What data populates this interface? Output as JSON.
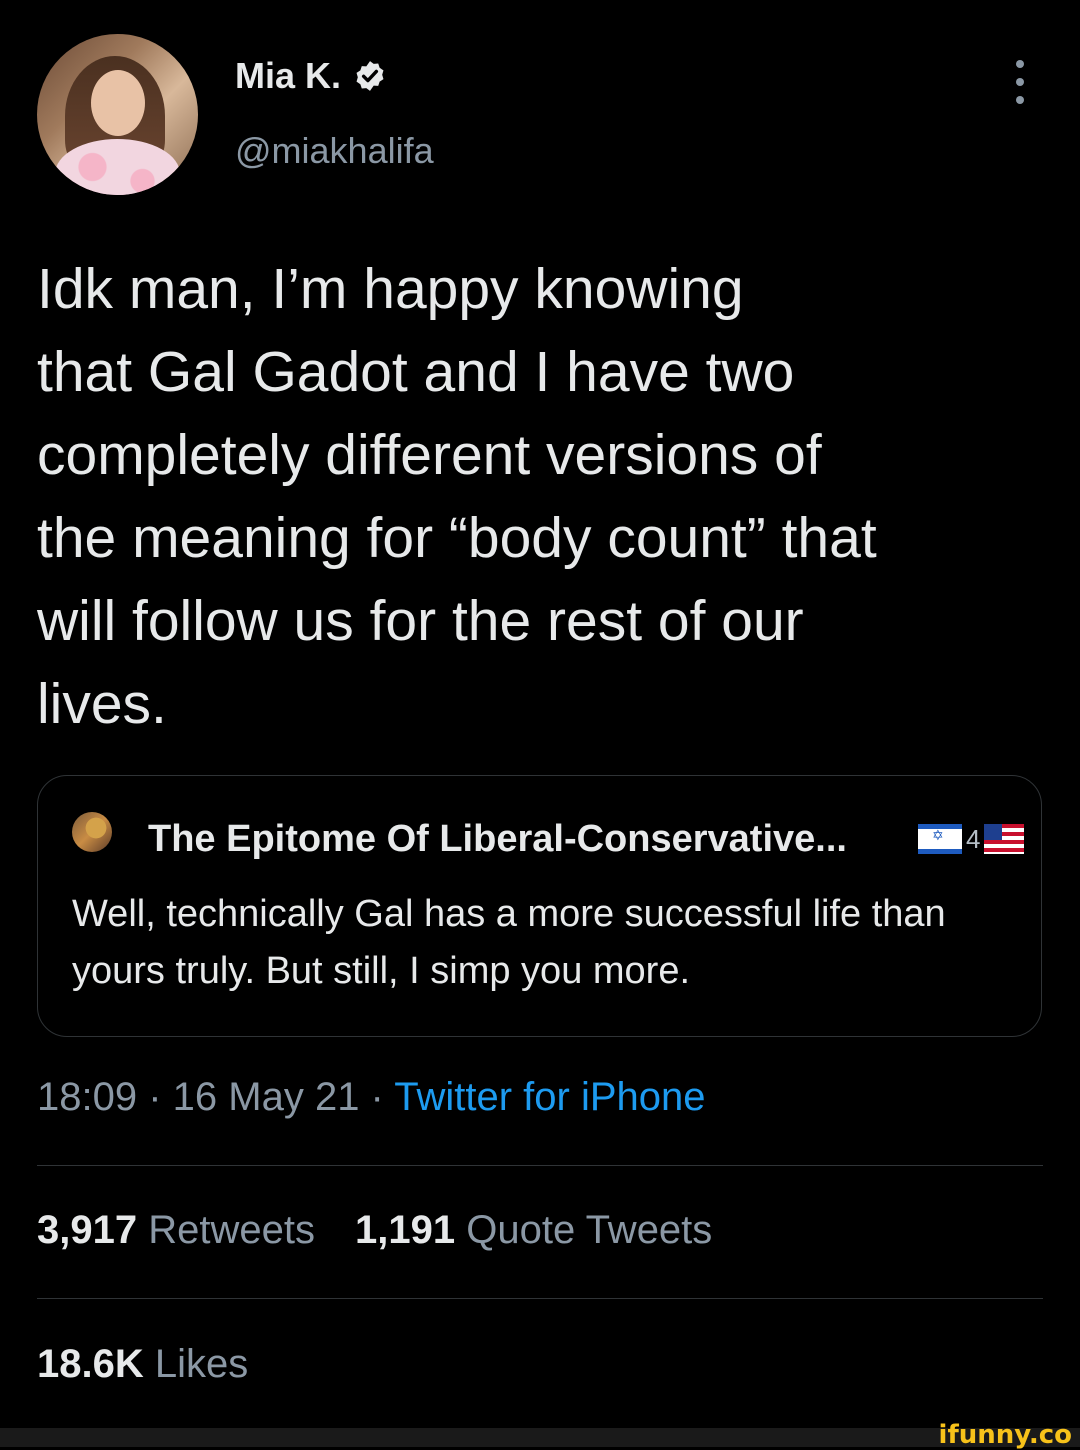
{
  "author": {
    "display_name": "Mia K.",
    "handle": "@miakhalifa",
    "verified_icon": "verified-badge-icon"
  },
  "tweet": {
    "text": "Idk man, I’m happy knowing\nthat Gal Gadot and I have two\ncompletely different versions of\nthe meaning for “body count” that\nwill follow us for the rest of our\nlives."
  },
  "quoted_tweet": {
    "author_name": "The Epitome Of Liberal-Conservative...",
    "flag_text": "4",
    "text": "Well, technically Gal has a more successful life than yours truly. But still, I simp you more."
  },
  "meta": {
    "time": "18:09",
    "date": "16 May 21",
    "source": "Twitter for iPhone",
    "separator": " · "
  },
  "stats": {
    "retweets_count": "3,917",
    "retweets_label": "Retweets",
    "quotes_count": "1,191",
    "quotes_label": "Quote Tweets",
    "likes_count": "18.6K",
    "likes_label": "Likes"
  },
  "watermark": "ifunny.co",
  "colors": {
    "background": "#000000",
    "text": "#e7e9ea",
    "muted": "#8b98a5",
    "link": "#1d9bf0",
    "verified": "#e7e9ea"
  }
}
